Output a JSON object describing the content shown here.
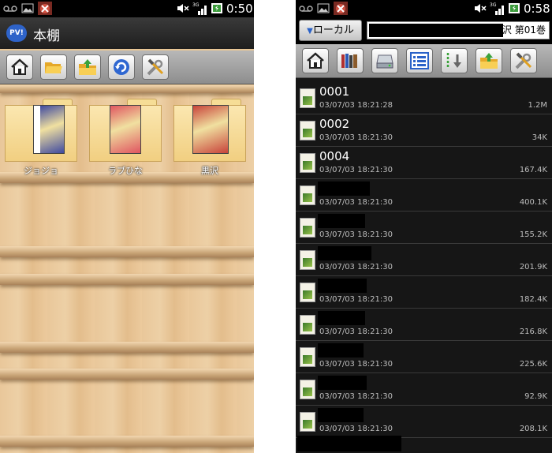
{
  "left": {
    "status": {
      "time": "0:50"
    },
    "app_title": "本棚",
    "app_icon_text": "PV!",
    "toolbar": [
      "home-icon",
      "folder-open-icon",
      "folder-up-icon",
      "refresh-icon",
      "settings-tools-icon"
    ],
    "books": [
      {
        "label": "ジョジョ",
        "cover_color": "#3f4aa0"
      },
      {
        "label": "ラブひな",
        "cover_color": "#e05560"
      },
      {
        "label": "黒沢",
        "cover_color": "#c8433a"
      }
    ]
  },
  "right": {
    "status": {
      "time": "0:58"
    },
    "local_button": "ローカル",
    "path_text": "沢 第01巻",
    "toolbar": [
      "home-icon",
      "bookshelf-icon",
      "drive-icon",
      "list-icon",
      "download-icon",
      "folder-up-icon",
      "settings-tools-icon"
    ],
    "files": [
      {
        "name": "0001",
        "date": "03/07/03 18:21:28",
        "size": "1.2M"
      },
      {
        "name": "0002",
        "date": "03/07/03 18:21:30",
        "size": "34K"
      },
      {
        "name": "0004",
        "date": "03/07/03 18:21:30",
        "size": "167.4K"
      },
      {
        "name": "",
        "date": "03/07/03 18:21:30",
        "size": "400.1K"
      },
      {
        "name": "",
        "date": "03/07/03 18:21:30",
        "size": "155.2K"
      },
      {
        "name": "",
        "date": "03/07/03 18:21:30",
        "size": "201.9K"
      },
      {
        "name": "",
        "date": "03/07/03 18:21:30",
        "size": "182.4K"
      },
      {
        "name": "",
        "date": "03/07/03 18:21:30",
        "size": "216.8K"
      },
      {
        "name": "",
        "date": "03/07/03 18:21:30",
        "size": "225.6K"
      },
      {
        "name": "",
        "date": "03/07/03 18:21:30",
        "size": "92.9K"
      },
      {
        "name": "",
        "date": "03/07/03 18:21:30",
        "size": "208.1K"
      }
    ]
  }
}
